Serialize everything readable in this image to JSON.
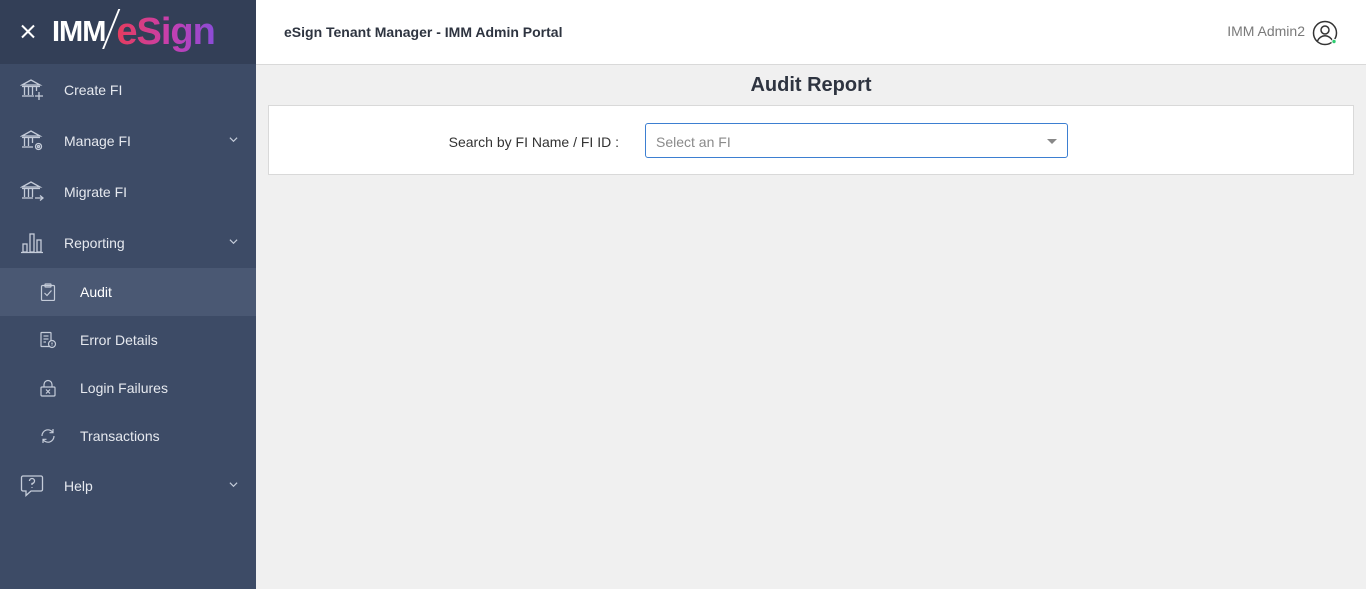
{
  "brand": {
    "logo_left": "IMM",
    "logo_right": "eSign"
  },
  "header": {
    "title": "eSign Tenant Manager - IMM Admin Portal",
    "user_name": "IMM Admin2"
  },
  "sidebar": {
    "items": [
      {
        "label": "Create FI",
        "icon": "bank-plus-icon"
      },
      {
        "label": "Manage FI",
        "icon": "bank-gear-icon",
        "expandable": true
      },
      {
        "label": "Migrate FI",
        "icon": "bank-arrow-icon"
      },
      {
        "label": "Reporting",
        "icon": "bar-chart-icon",
        "expandable": true
      }
    ],
    "reporting_children": [
      {
        "label": "Audit",
        "icon": "clipboard-check-icon",
        "active": true
      },
      {
        "label": "Error Details",
        "icon": "document-error-icon"
      },
      {
        "label": "Login Failures",
        "icon": "lock-x-icon"
      },
      {
        "label": "Transactions",
        "icon": "refresh-icon"
      }
    ],
    "help": {
      "label": "Help",
      "icon": "help-bubble-icon",
      "expandable": true
    }
  },
  "main": {
    "page_title": "Audit Report",
    "search_label": "Search by FI Name / FI ID :",
    "select_placeholder": "Select an FI"
  },
  "colors": {
    "sidebar_bg": "#3d4b66",
    "brand_bg": "#333f57",
    "active_item_bg": "#4a5873",
    "select_border": "#3d7fd1",
    "online_dot": "#2ecc71"
  }
}
